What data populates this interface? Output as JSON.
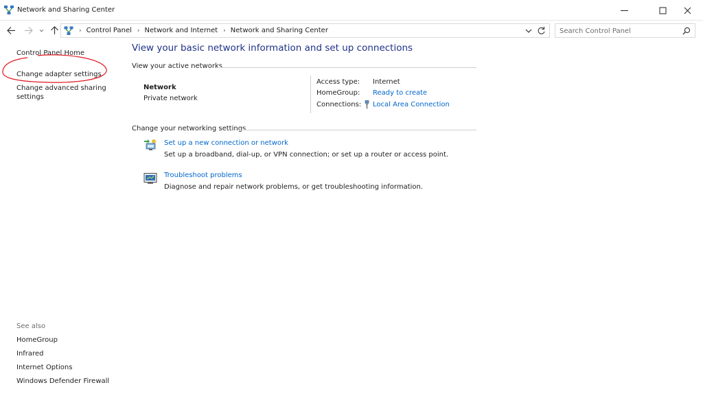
{
  "window": {
    "title": "Network and Sharing Center"
  },
  "address_bar": {
    "crumbs": [
      "Control Panel",
      "Network and Internet",
      "Network and Sharing Center"
    ],
    "search_placeholder": "Search Control Panel"
  },
  "left_pane": {
    "home": "Control Panel Home",
    "change_adapter": "Change adapter settings",
    "change_sharing_line1": "Change advanced sharing",
    "change_sharing_line2": "settings",
    "see_also_title": "See also",
    "see_also": [
      "HomeGroup",
      "Infrared",
      "Internet Options",
      "Windows Defender Firewall"
    ]
  },
  "main": {
    "title": "View your basic network information and set up connections",
    "active_networks_heading": "View your active networks",
    "network": {
      "name": "Network",
      "category": "Private network",
      "access_type_label": "Access type:",
      "access_type_value": "Internet",
      "homegroup_label": "HomeGroup:",
      "homegroup_value": "Ready to create",
      "connections_label": "Connections:",
      "connections_value": "Local Area Connection"
    },
    "settings_heading": "Change your networking settings",
    "tasks": [
      {
        "icon": "new-connection-icon",
        "link": "Set up a new connection or network",
        "desc": "Set up a broadband, dial-up, or VPN connection; or set up a router or access point."
      },
      {
        "icon": "troubleshoot-icon",
        "link": "Troubleshoot problems",
        "desc": "Diagnose and repair network problems, or get troubleshooting information."
      }
    ]
  },
  "colors": {
    "title_blue": "#1e3287",
    "link_blue": "#0066cc",
    "annotation_red": "#e0141e"
  }
}
